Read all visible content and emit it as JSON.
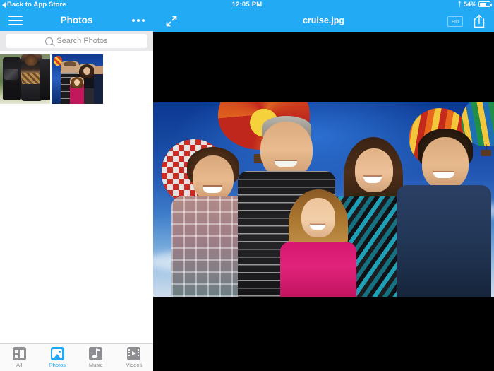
{
  "status_bar": {
    "back_label": "Back to App Store",
    "time": "12:05 PM",
    "battery_percent": "54%",
    "bluetooth_icon": "bluetooth-icon",
    "battery_icon": "battery-icon"
  },
  "sidebar": {
    "nav": {
      "menu_icon": "hamburger-icon",
      "title": "Photos",
      "more_icon": "more-options-icon"
    },
    "search": {
      "placeholder": "Search Photos",
      "value": "",
      "icon": "search-icon"
    },
    "thumbnails": [
      {
        "name": "thumbnail-1",
        "alt": "Two people standing outdoors by a fence"
      },
      {
        "name": "thumbnail-2",
        "alt": "Family portrait on blue backdrop"
      }
    ],
    "tabs": [
      {
        "label": "All",
        "icon": "all-files-icon",
        "active": false
      },
      {
        "label": "Photos",
        "icon": "photos-icon",
        "active": true
      },
      {
        "label": "Music",
        "icon": "music-note-icon",
        "active": false
      },
      {
        "label": "Videos",
        "icon": "video-film-icon",
        "active": false
      }
    ]
  },
  "viewer": {
    "expand_icon": "expand-arrows-icon",
    "filename": "cruise.jpg",
    "hd_badge": "HD",
    "share_icon": "share-upload-icon",
    "photo_alt": "Family of five posed in front of a hot air balloon backdrop"
  },
  "colors": {
    "accent": "#22aaf5",
    "tab_inactive": "#8e8e93",
    "search_bg": "#e8e8ea",
    "stage_bg": "#000000"
  }
}
